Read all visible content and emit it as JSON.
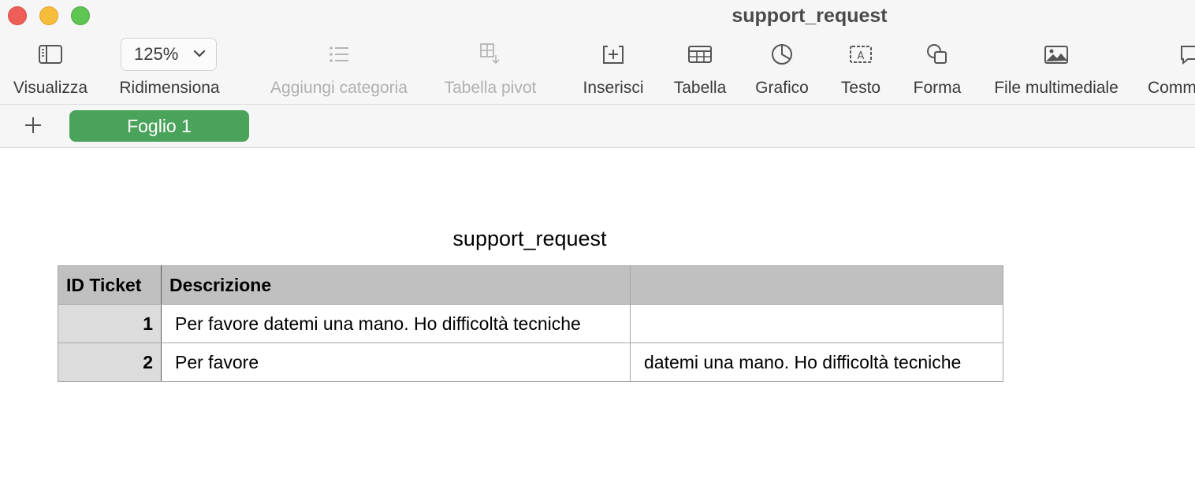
{
  "window": {
    "title": "support_request"
  },
  "toolbar": {
    "items": [
      {
        "label": "Visualizza",
        "icon": "sidebar-icon",
        "enabled": true
      },
      {
        "label": "Ridimensiona",
        "icon": "zoom-dropdown",
        "enabled": true,
        "value": "125%"
      },
      {
        "label": "Aggiungi categoria",
        "icon": "list-icon",
        "enabled": false
      },
      {
        "label": "Tabella pivot",
        "icon": "pivot-table-icon",
        "enabled": false
      },
      {
        "label": "Inserisci",
        "icon": "insert-icon",
        "enabled": true
      },
      {
        "label": "Tabella",
        "icon": "table-icon",
        "enabled": true
      },
      {
        "label": "Grafico",
        "icon": "chart-icon",
        "enabled": true
      },
      {
        "label": "Testo",
        "icon": "text-box-icon",
        "enabled": true
      },
      {
        "label": "Forma",
        "icon": "shape-icon",
        "enabled": true
      },
      {
        "label": "File multimediale",
        "icon": "media-icon",
        "enabled": true
      },
      {
        "label": "Comm",
        "icon": "comment-icon",
        "enabled": true
      }
    ]
  },
  "sheets": {
    "tabs": [
      {
        "label": "Foglio 1",
        "active": true
      }
    ],
    "active_color": "#4aa35a"
  },
  "table": {
    "title": "support_request",
    "headers": [
      "ID Ticket",
      "Descrizione",
      ""
    ],
    "rows": [
      [
        "1",
        "Per favore datemi una mano. Ho difficoltà tecniche",
        ""
      ],
      [
        "2",
        "Per favore",
        "datemi una mano. Ho difficoltà tecniche"
      ]
    ]
  }
}
